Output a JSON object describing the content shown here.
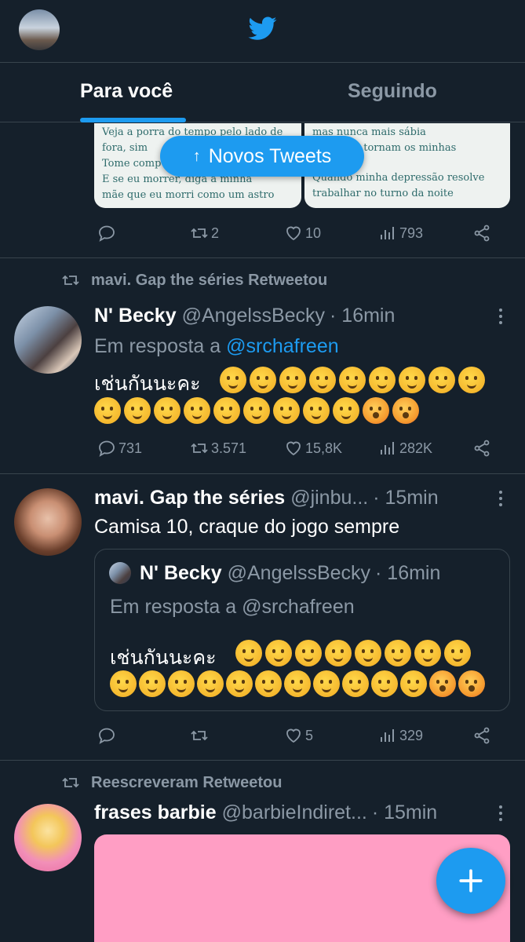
{
  "header": {
    "logo_icon": "twitter-bird-icon",
    "brand_color": "#1d9bf0"
  },
  "tabs": [
    {
      "label": "Para você",
      "active": true
    },
    {
      "label": "Seguindo",
      "active": false
    }
  ],
  "new_tweets_pill": {
    "label": "Novos Tweets",
    "icon": "arrow-up-icon"
  },
  "partial_tweet": {
    "media_text_left": [
      "Veja a porra do tempo pelo lado de",
      "fora, sim",
      "Tome comp",
      "E se eu morrer, diga à minha",
      "mãe que eu morri como um astro"
    ],
    "media_text_right": [
      "mas nunca mais sábia",
      "nostos se tornam os minhas",
      "Quando minha depressão resolve",
      "trabalhar no turno da noite"
    ],
    "stats": {
      "replies": "",
      "retweets": "2",
      "likes": "10",
      "views": "793"
    }
  },
  "tweet1": {
    "retweeted_by": "mavi. Gap the séries Retweetou",
    "name": "N' Becky",
    "handle": "@AngelssBecky",
    "time": "· 16min",
    "reply_prefix": "Em resposta a",
    "reply_mention": "@srchafreen",
    "text": "เช่นกันนะคะ",
    "stats": {
      "replies": "731",
      "retweets": "3.571",
      "likes": "15,8K",
      "views": "282K"
    }
  },
  "tweet2": {
    "name": "mavi. Gap the séries",
    "handle": "@jinbu...",
    "time": "· 15min",
    "text": "Camisa 10, craque do jogo sempre",
    "quote": {
      "name": "N' Becky",
      "handle": "@AngelssBecky",
      "time": "· 16min",
      "reply_line": "Em resposta a @srchafreen",
      "text": "เช่นกันนะคะ"
    },
    "stats": {
      "replies": "",
      "retweets": "",
      "likes": "5",
      "views": "329"
    }
  },
  "tweet3": {
    "retweeted_by": "Reescreveram Retweetou",
    "name": "frases barbie",
    "handle": "@barbieIndiret...",
    "time": "· 15min"
  },
  "fab": {
    "icon": "plus-icon"
  }
}
